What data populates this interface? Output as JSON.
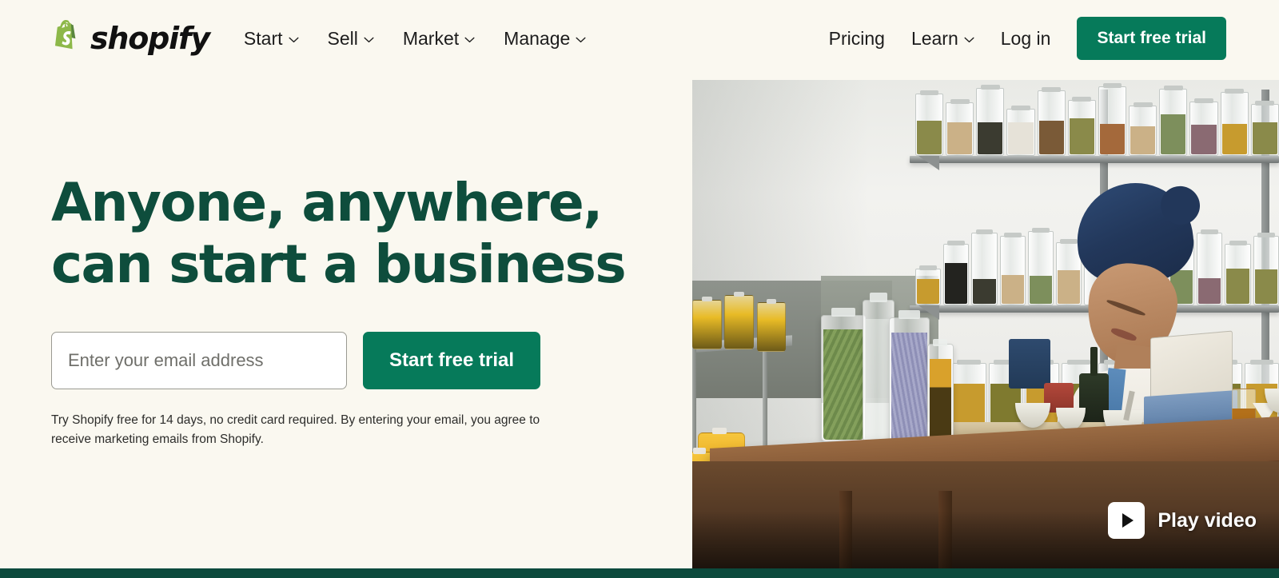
{
  "brand": {
    "name": "shopify",
    "logo_icon": "shopify-bag-icon",
    "accent_green": "#067a5a",
    "headline_green": "#0e4d3c",
    "page_background": "#faf8f0",
    "footer_bar_color": "#0c4a3d"
  },
  "nav": {
    "left_items": [
      {
        "label": "Start",
        "has_dropdown": true,
        "icon": "chevron-down-icon"
      },
      {
        "label": "Sell",
        "has_dropdown": true,
        "icon": "chevron-down-icon"
      },
      {
        "label": "Market",
        "has_dropdown": true,
        "icon": "chevron-down-icon"
      },
      {
        "label": "Manage",
        "has_dropdown": true,
        "icon": "chevron-down-icon"
      }
    ],
    "right_items": [
      {
        "label": "Pricing",
        "has_dropdown": false
      },
      {
        "label": "Learn",
        "has_dropdown": true,
        "icon": "chevron-down-icon"
      },
      {
        "label": "Log in",
        "has_dropdown": false
      }
    ],
    "cta_label": "Start free trial"
  },
  "hero": {
    "headline_line1": "Anyone, anywhere,",
    "headline_line2": "can start a business",
    "email_placeholder": "Enter your email address",
    "email_value": "",
    "submit_label": "Start free trial",
    "disclaimer": "Try Shopify free for 14 days, no credit card required. By entering your email, you agree to receive marketing emails from Shopify."
  },
  "media": {
    "play_label": "Play video",
    "play_icon": "play-triangle-icon",
    "alt_description": "Woman in blue head wrap working on a laptop at a wooden table surrounded by glass jars of herbs and preserves"
  }
}
